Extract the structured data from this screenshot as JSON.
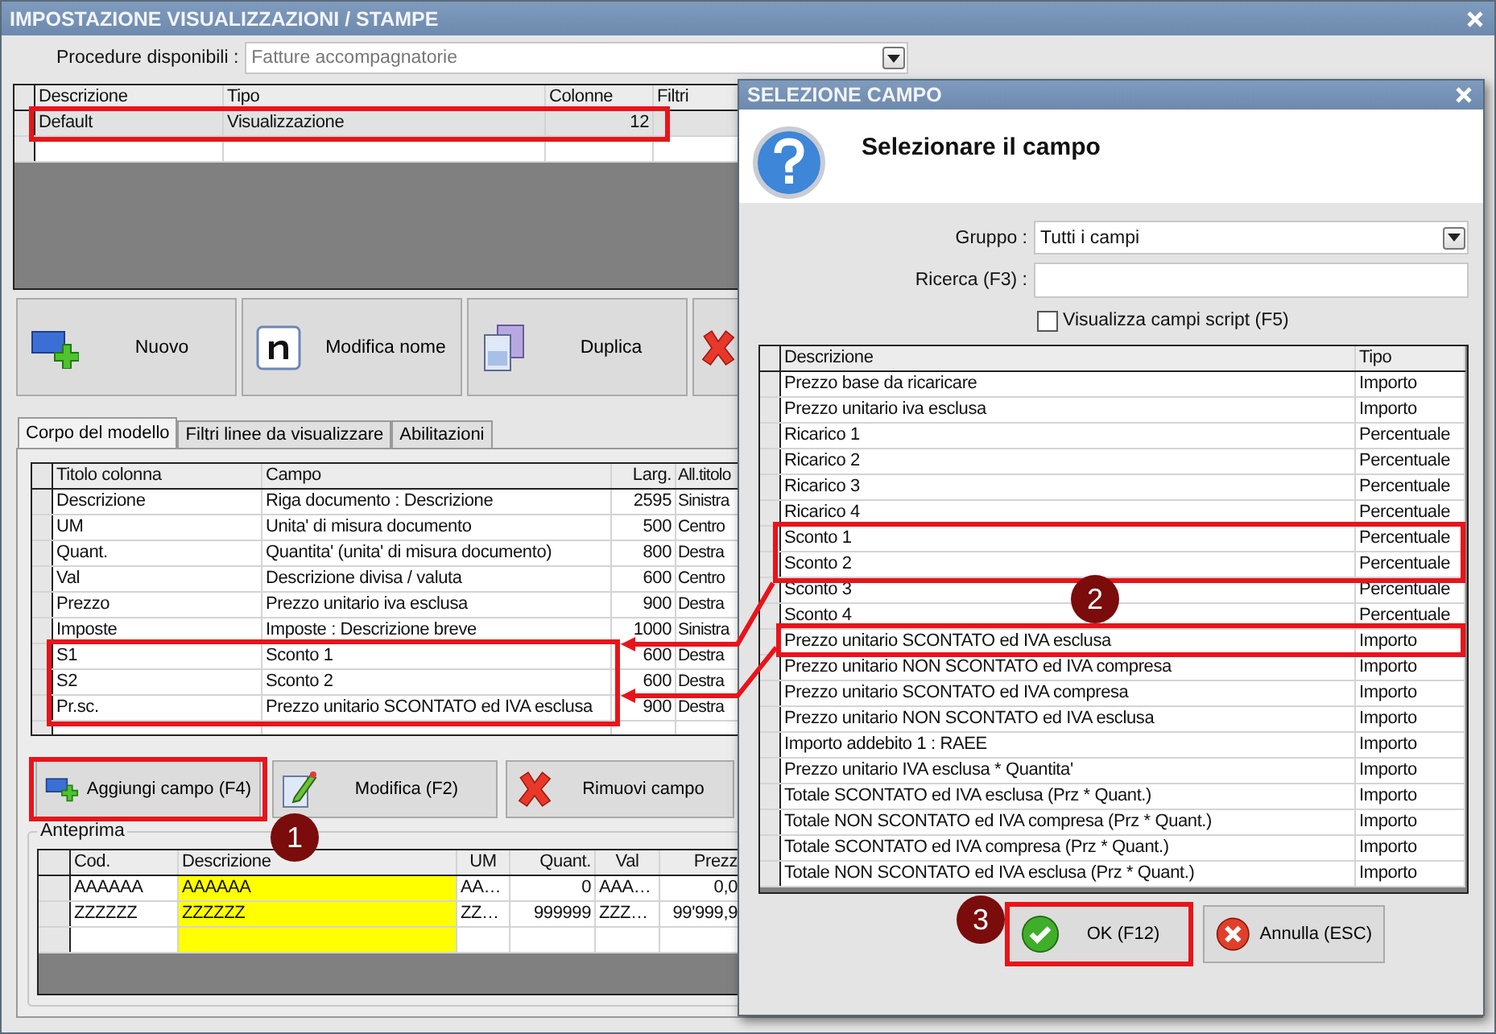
{
  "window": {
    "title": "IMPOSTAZIONE VISUALIZZAZIONI / STAMPE"
  },
  "procedure": {
    "label": "Procedure disponibili :",
    "value": "Fatture accompagnatorie"
  },
  "models_table": {
    "columns": [
      "Descrizione",
      "Tipo",
      "Colonne",
      "Filtri"
    ],
    "rows": [
      {
        "descrizione": "Default",
        "tipo": "Visualizzazione",
        "colonne": "12",
        "selected": true
      }
    ]
  },
  "toolbar": [
    {
      "kind": "new",
      "label": "Nuovo"
    },
    {
      "kind": "rename",
      "label": "Modifica nome"
    },
    {
      "kind": "duplicate",
      "label": "Duplica"
    },
    {
      "kind": "delete"
    }
  ],
  "tabs": [
    {
      "label": "Corpo del modello",
      "selected": true
    },
    {
      "label": "Filtri linee da visualizzare",
      "selected": false
    },
    {
      "label": "Abilitazioni",
      "selected": false
    }
  ],
  "fields_table": {
    "columns": [
      "Titolo colonna",
      "Campo",
      "Larg.",
      "All.titolo"
    ],
    "rows": [
      {
        "titolo": "Descrizione",
        "campo": "Riga documento : Descrizione",
        "larg": "2595",
        "allineamento": "Sinistra"
      },
      {
        "titolo": "UM",
        "campo": "Unita' di misura documento",
        "larg": "500",
        "allineamento": "Centro"
      },
      {
        "titolo": "Quant.",
        "campo": "Quantita' (unita' di misura documento)",
        "larg": "800",
        "allineamento": "Destra"
      },
      {
        "titolo": "Val",
        "campo": "Descrizione divisa / valuta",
        "larg": "600",
        "allineamento": "Centro"
      },
      {
        "titolo": "Prezzo",
        "campo": "Prezzo unitario iva esclusa",
        "larg": "900",
        "allineamento": "Destra"
      },
      {
        "titolo": "Imposte",
        "campo": "Imposte : Descrizione breve",
        "larg": "1000",
        "allineamento": "Sinistra"
      },
      {
        "titolo": "S1",
        "campo": "Sconto 1",
        "larg": "600",
        "allineamento": "Destra"
      },
      {
        "titolo": "S2",
        "campo": "Sconto 2",
        "larg": "600",
        "allineamento": "Destra"
      },
      {
        "titolo": "Pr.sc.",
        "campo": "Prezzo unitario SCONTATO ed IVA esclusa",
        "larg": "900",
        "allineamento": "Destra"
      }
    ]
  },
  "field_buttons": [
    {
      "kind": "add",
      "label": "Aggiungi campo (F4)"
    },
    {
      "kind": "edit",
      "label": "Modifica (F2)"
    },
    {
      "kind": "remove",
      "label": "Rimuovi campo"
    }
  ],
  "preview": {
    "label": "Anteprima",
    "columns": [
      "Cod.",
      "Descrizione",
      "UM",
      "Quant.",
      "Val",
      "Prezz"
    ],
    "rows": [
      [
        "AAAAAA",
        "AAAAAA",
        "AA…",
        "0",
        "AAA…",
        "0,0"
      ],
      [
        "ZZZZZZ",
        "ZZZZZZ",
        "ZZ…",
        "999999",
        "ZZZ…",
        "99'999,9"
      ]
    ]
  },
  "dialog": {
    "title": "SELEZIONE CAMPO",
    "heading": "Selezionare il campo",
    "gruppo": {
      "label": "Gruppo :",
      "value": "Tutti i campi"
    },
    "ricerca": {
      "label": "Ricerca (F3) :"
    },
    "checkbox": {
      "label": "Visualizza campi script (F5)",
      "checked": false
    },
    "columns": [
      "Descrizione",
      "Tipo"
    ],
    "rows": [
      {
        "descrizione": "Prezzo base da ricaricare",
        "tipo": "Importo"
      },
      {
        "descrizione": "Prezzo unitario iva esclusa",
        "tipo": "Importo"
      },
      {
        "descrizione": "Ricarico 1",
        "tipo": "Percentuale"
      },
      {
        "descrizione": "Ricarico 2",
        "tipo": "Percentuale"
      },
      {
        "descrizione": "Ricarico 3",
        "tipo": "Percentuale"
      },
      {
        "descrizione": "Ricarico 4",
        "tipo": "Percentuale"
      },
      {
        "descrizione": "Sconto 1",
        "tipo": "Percentuale"
      },
      {
        "descrizione": "Sconto 2",
        "tipo": "Percentuale"
      },
      {
        "descrizione": "Sconto 3",
        "tipo": "Percentuale"
      },
      {
        "descrizione": "Sconto 4",
        "tipo": "Percentuale"
      },
      {
        "descrizione": "Prezzo unitario SCONTATO ed IVA esclusa",
        "tipo": "Importo"
      },
      {
        "descrizione": "Prezzo unitario NON SCONTATO ed IVA compresa",
        "tipo": "Importo"
      },
      {
        "descrizione": "Prezzo unitario SCONTATO ed IVA compresa",
        "tipo": "Importo"
      },
      {
        "descrizione": "Prezzo unitario NON SCONTATO ed IVA esclusa",
        "tipo": "Importo"
      },
      {
        "descrizione": "Importo addebito 1 : RAEE",
        "tipo": "Importo"
      },
      {
        "descrizione": "Prezzo unitario IVA esclusa * Quantita'",
        "tipo": "Importo"
      },
      {
        "descrizione": "Totale SCONTATO ed IVA esclusa (Prz * Quant.)",
        "tipo": "Importo"
      },
      {
        "descrizione": "Totale NON SCONTATO ed IVA compresa (Prz * Quant.)",
        "tipo": "Importo"
      },
      {
        "descrizione": "Totale SCONTATO ed IVA compresa (Prz * Quant.)",
        "tipo": "Importo"
      },
      {
        "descrizione": "Totale NON SCONTATO ed IVA esclusa (Prz * Quant.)",
        "tipo": "Importo"
      }
    ],
    "buttons": [
      {
        "kind": "ok",
        "label": "OK (F12)"
      },
      {
        "kind": "cancel",
        "label": "Annulla (ESC)"
      }
    ]
  },
  "annotations": [
    {
      "label": "1"
    },
    {
      "label": "2"
    },
    {
      "label": "3"
    }
  ]
}
